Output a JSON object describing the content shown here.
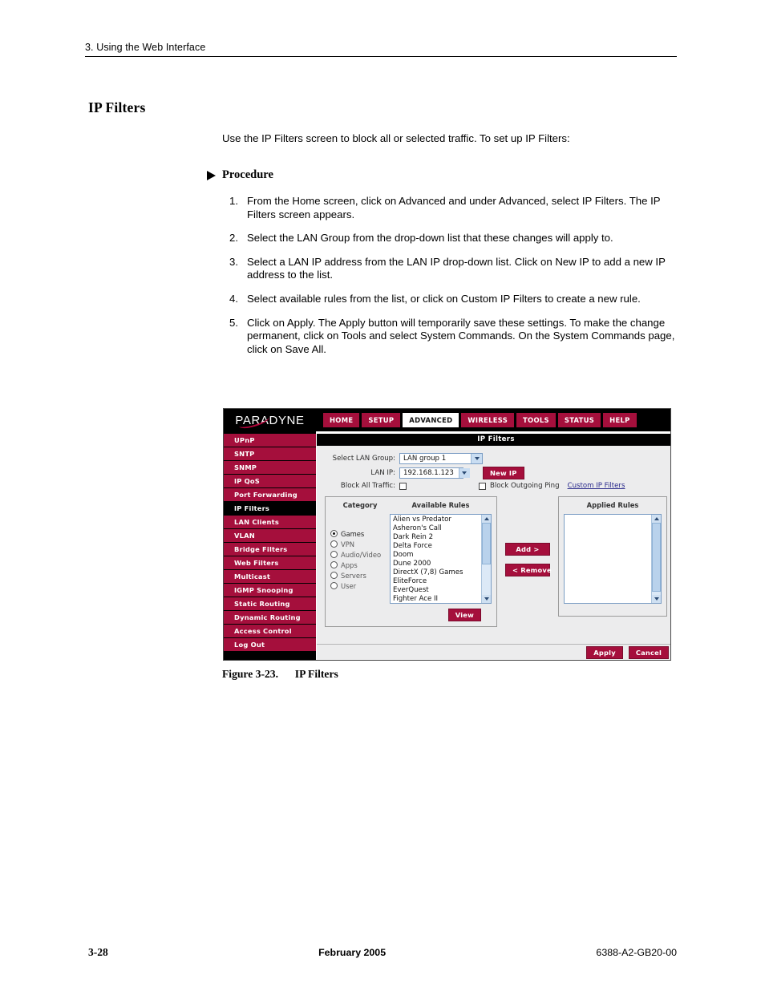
{
  "page": {
    "running_header": "3. Using the Web Interface",
    "section_heading": "IP Filters",
    "intro": "Use the IP Filters screen to block all or selected traffic. To set up IP Filters:",
    "procedure_label": "Procedure",
    "steps": [
      {
        "num": "1.",
        "text": "From the Home screen, click on Advanced and under Advanced, select IP Filters. The IP Filters screen appears."
      },
      {
        "num": "2.",
        "text": "Select the LAN Group from the drop-down list that these changes will apply to."
      },
      {
        "num": "3.",
        "text": "Select a LAN IP address from the LAN IP drop-down list. Click on New IP to add a new IP address to the list."
      },
      {
        "num": "4.",
        "text": " Select available rules from the list, or click on Custom IP Filters to create a new rule."
      },
      {
        "num": "5.",
        "text": "Click on Apply. The Apply button will temporarily save these settings. To make the change permanent, click on Tools and select System Commands. On the System Commands page, click on Save All."
      }
    ],
    "figure_caption_label": "Figure 3-23.",
    "figure_caption_title": "IP Filters",
    "footer": {
      "page_number": "3-28",
      "date": "February 2005",
      "doc_number": "6388-A2-GB20-00"
    }
  },
  "colors": {
    "brand_red": "#a50f3c",
    "black": "#000000",
    "pane_gray": "#ececed",
    "link_blue": "#2a2a8c"
  },
  "screenshot": {
    "logo": "PARADYNE",
    "nav_tabs": [
      {
        "label": "HOME",
        "active": false
      },
      {
        "label": "SETUP",
        "active": false
      },
      {
        "label": "ADVANCED",
        "active": true
      },
      {
        "label": "WIRELESS",
        "active": false
      },
      {
        "label": "TOOLS",
        "active": false
      },
      {
        "label": "STATUS",
        "active": false
      },
      {
        "label": "HELP",
        "active": false
      }
    ],
    "sidebar": [
      {
        "label": "UPnP",
        "active": false
      },
      {
        "label": "SNTP",
        "active": false
      },
      {
        "label": "SNMP",
        "active": false
      },
      {
        "label": "IP QoS",
        "active": false
      },
      {
        "label": "Port Forwarding",
        "active": false
      },
      {
        "label": "IP Filters",
        "active": true
      },
      {
        "label": "LAN Clients",
        "active": false
      },
      {
        "label": "VLAN",
        "active": false
      },
      {
        "label": "Bridge Filters",
        "active": false
      },
      {
        "label": "Web Filters",
        "active": false
      },
      {
        "label": "Multicast",
        "active": false
      },
      {
        "label": "IGMP Snooping",
        "active": false
      },
      {
        "label": "Static Routing",
        "active": false
      },
      {
        "label": "Dynamic Routing",
        "active": false
      },
      {
        "label": "Access Control",
        "active": false
      },
      {
        "label": "Log Out",
        "active": false
      }
    ],
    "content_title": "IP Filters",
    "form": {
      "lan_group_label": "Select LAN Group:",
      "lan_group_value": "LAN group 1",
      "lan_ip_label": "LAN IP:",
      "lan_ip_value": "192.168.1.123",
      "new_ip_button": "New IP",
      "block_all_traffic_label": "Block All Traffic:",
      "block_all_traffic_checked": false,
      "block_outgoing_ping_label": "Block Outgoing Ping",
      "block_outgoing_ping_checked": false,
      "custom_ip_filters_link": "Custom IP Filters"
    },
    "rules": {
      "category_header": "Category",
      "available_header": "Available Rules",
      "applied_header": "Applied Rules",
      "categories": [
        {
          "label": "Games",
          "selected": true
        },
        {
          "label": "VPN",
          "selected": false
        },
        {
          "label": "Audio/Video",
          "selected": false
        },
        {
          "label": "Apps",
          "selected": false
        },
        {
          "label": "Servers",
          "selected": false
        },
        {
          "label": "User",
          "selected": false
        }
      ],
      "available_items": [
        "Alien vs Predator",
        "Asheron's Call",
        "Dark Rein 2",
        "Delta Force",
        "Doom",
        "Dune 2000",
        "DirectX (7,8) Games",
        "EliteForce",
        "EverQuest",
        "Fighter Ace II"
      ],
      "applied_items": [],
      "view_button": "View",
      "add_button": "Add >",
      "remove_button": "< Remove"
    },
    "actions": {
      "apply_button": "Apply",
      "cancel_button": "Cancel"
    }
  }
}
